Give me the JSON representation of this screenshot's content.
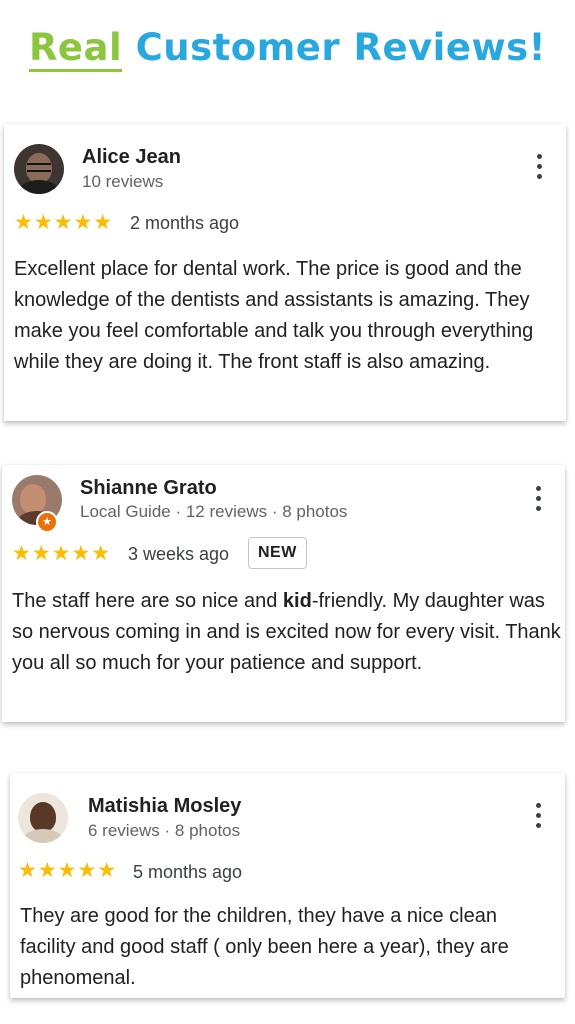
{
  "header": {
    "title_highlight": "Real",
    "title_rest": "Customer Reviews!"
  },
  "colors": {
    "accent_green": "#8cc63f",
    "accent_blue": "#29a8e0",
    "star": "#fbbc04"
  },
  "icons": {
    "menu": "three-dot-vertical-menu-icon",
    "star": "star-icon",
    "local_guide": "local-guide-badge-icon"
  },
  "reviews": [
    {
      "name": "Alice Jean",
      "meta": "10 reviews",
      "stars": "★★★★★",
      "rating": 5,
      "time": "2 months ago",
      "body": "Excellent place for dental work. The price is good and the knowledge of the dentists and assistants is amazing. They make you feel comfortable and talk you through everything while they are doing it. The front staff is also amazing."
    },
    {
      "name": "Shianne Grato",
      "meta": "Local Guide · 12 reviews · 8 photos",
      "stars": "★★★★★",
      "rating": 5,
      "time": "3 weeks ago",
      "badge": "NEW",
      "body_before": "The staff here are so nice and ",
      "body_bold": "kid",
      "body_after": "-friendly. My daughter was so nervous coming in and is excited now for every visit. Thank you all so much for your patience and support."
    },
    {
      "name": "Matishia Mosley",
      "meta": "6 reviews · 8 photos",
      "stars": "★★★★★",
      "rating": 5,
      "time": "5 months ago",
      "body": "They are good for the children, they have a nice clean facility and good staff ( only been here a year), they are phenomenal."
    }
  ]
}
